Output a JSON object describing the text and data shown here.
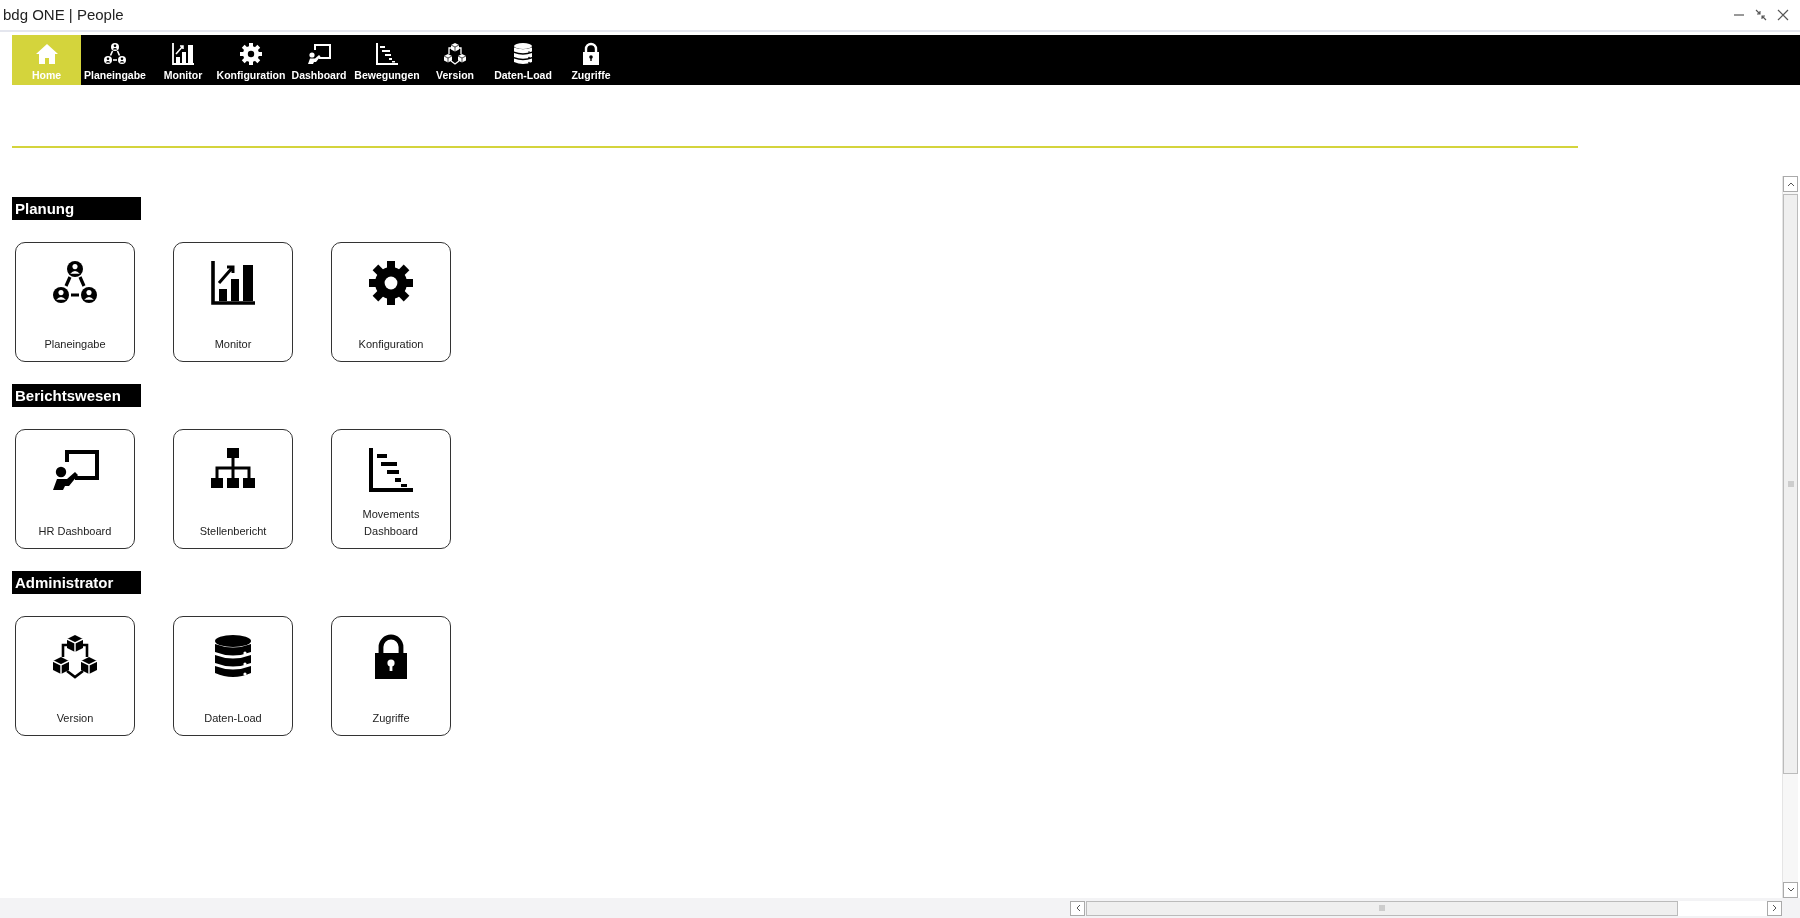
{
  "window": {
    "title": "bdg ONE | People"
  },
  "nav": [
    {
      "label": "Home",
      "selected": true
    },
    {
      "label": "Planeingabe",
      "selected": false
    },
    {
      "label": "Monitor",
      "selected": false
    },
    {
      "label": "Konfiguration",
      "selected": false
    },
    {
      "label": "Dashboard",
      "selected": false
    },
    {
      "label": "Bewegungen",
      "selected": false
    },
    {
      "label": "Version",
      "selected": false
    },
    {
      "label": "Daten-Load",
      "selected": false
    },
    {
      "label": "Zugriffe",
      "selected": false
    }
  ],
  "sections": [
    {
      "title": "Planung",
      "tiles": [
        {
          "label": "Planeingabe"
        },
        {
          "label": "Monitor"
        },
        {
          "label": "Konfiguration"
        }
      ]
    },
    {
      "title": "Berichtswesen",
      "tiles": [
        {
          "label": "HR Dashboard"
        },
        {
          "label": "Stellenbericht"
        },
        {
          "label": "Movements Dashboard"
        }
      ]
    },
    {
      "title": "Administrator",
      "tiles": [
        {
          "label": "Version"
        },
        {
          "label": "Daten-Load"
        },
        {
          "label": "Zugriffe"
        }
      ]
    }
  ]
}
